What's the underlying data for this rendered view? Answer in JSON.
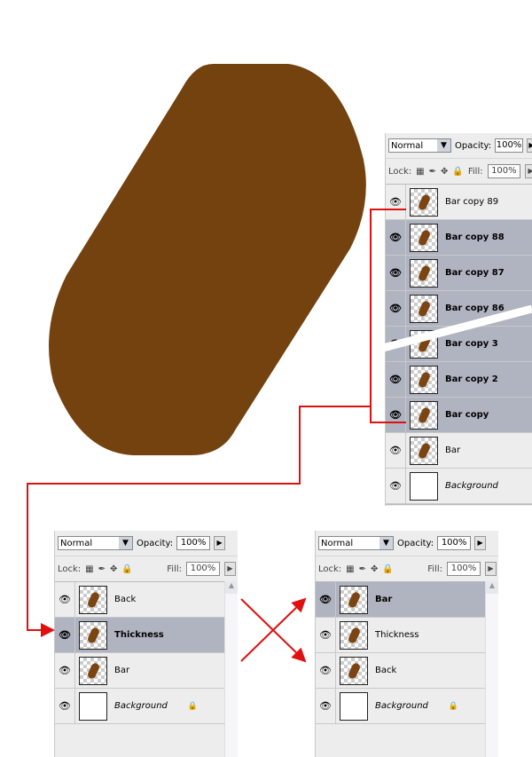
{
  "colors": {
    "shape": "#74420f",
    "selected_row": "#b0b3c0",
    "annotation": "#e01010"
  },
  "labels": {
    "blend": "Normal",
    "opacity": "Opacity:",
    "opacity_value": "100%",
    "lock": "Lock:",
    "fill": "Fill:",
    "fill_value": "100%"
  },
  "panel_main": {
    "layers": [
      {
        "name": "Bar copy 89",
        "active": false
      },
      {
        "name": "Bar copy 88",
        "active": true
      },
      {
        "name": "Bar copy 87",
        "active": true
      },
      {
        "name": "Bar copy 86",
        "active": true
      },
      {
        "name": "Bar copy 3",
        "active": true
      },
      {
        "name": "Bar copy 2",
        "active": true
      },
      {
        "name": "Bar copy",
        "active": true
      },
      {
        "name": "Bar",
        "active": false
      },
      {
        "name": "Background",
        "active": false,
        "background": true
      }
    ],
    "footer_icons": [
      "link-icon",
      "fx-icon",
      "mask-icon",
      "adjustment-icon",
      "folder-icon",
      "new-layer-icon"
    ]
  },
  "panel_before": {
    "layers": [
      {
        "name": "Back",
        "active": false
      },
      {
        "name": "Thickness",
        "active": true
      },
      {
        "name": "Bar",
        "active": false
      },
      {
        "name": "Background",
        "active": false,
        "background": true,
        "locked": true
      }
    ]
  },
  "panel_after": {
    "layers": [
      {
        "name": "Bar",
        "active": true
      },
      {
        "name": "Thickness",
        "active": false
      },
      {
        "name": "Back",
        "active": false
      },
      {
        "name": "Background",
        "active": false,
        "background": true,
        "locked": true
      }
    ]
  }
}
